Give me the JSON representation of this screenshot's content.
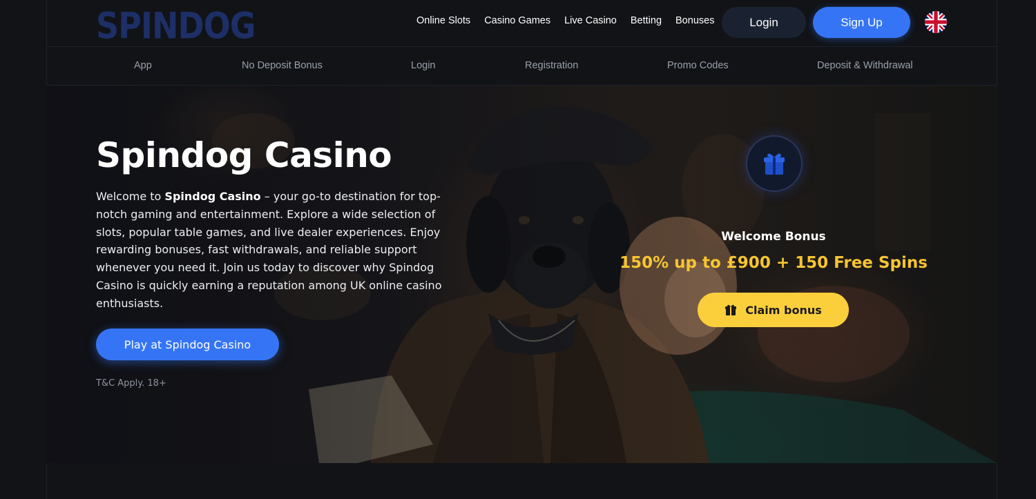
{
  "brand": {
    "logo_text": "SPINDOG"
  },
  "main_nav": [
    "Online Slots",
    "Casino Games",
    "Live Casino",
    "Betting",
    "Bonuses"
  ],
  "header": {
    "login_label": "Login",
    "signup_label": "Sign Up",
    "language_flag": "uk-flag-icon"
  },
  "sub_nav": [
    "App",
    "No Deposit Bonus",
    "Login",
    "Registration",
    "Promo Codes",
    "Deposit & Withdrawal"
  ],
  "hero": {
    "title": "Spindog Casino",
    "desc_prefix": "Welcome to ",
    "desc_bold": "Spindog Casino",
    "desc_rest": " – your go-to destination for top-notch gaming and entertainment. Explore a wide selection of slots, popular table games, and live dealer experiences. Enjoy rewarding bonuses, fast withdrawals, and reliable support whenever you need it. Join us today to discover why Spindog Casino is quickly earning a reputation among UK online casino enthusiasts.",
    "cta_label": "Play at Spindog Casino",
    "terms": "T&C Apply. 18+"
  },
  "bonus": {
    "label": "Welcome Bonus",
    "offer": "150% up to £900 + 150 Free Spins",
    "claim_label": "Claim bonus",
    "icon": "gift-icon"
  },
  "colors": {
    "background": "#111317",
    "accent_blue": "#3575f5",
    "accent_yellow": "#fbcf3b",
    "offer_yellow": "#f7c531",
    "logo_blue": "#1d2f66"
  }
}
